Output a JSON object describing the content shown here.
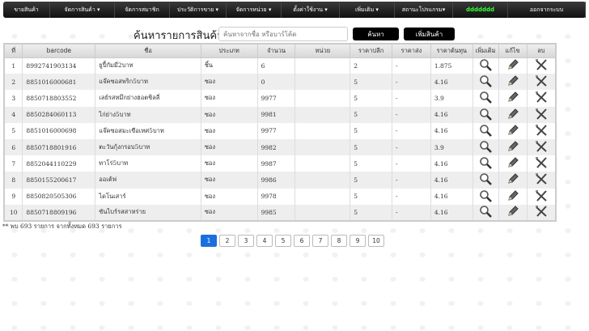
{
  "nav": [
    {
      "label": "ขายสินค้า",
      "w": 58
    },
    {
      "label": "จัดการสินค้า ▾",
      "w": 80
    },
    {
      "label": "จัดการสมาชิก",
      "w": 68
    },
    {
      "label": "ประวัติการขาย ▾",
      "w": 70
    },
    {
      "label": "จัดการหน่วย ▾",
      "w": 68
    },
    {
      "label": "ตั้งค่าใช้งาน ▾",
      "w": 72
    },
    {
      "label": "เพิ่มเติม ▾",
      "w": 68
    },
    {
      "label": "สถานะโปรแกรม▾",
      "w": 72
    },
    {
      "label": "ddddddd",
      "w": 68,
      "green": true
    },
    {
      "label": "ออกจากระบบ",
      "w": 96
    }
  ],
  "search": {
    "title": "ค้นหารายการสินค้า",
    "placeholder": "ค้นหาจากชื่อ หรือบาร์โค้ด",
    "search_label": "ค้นหา",
    "add_label": "เพิ่มสินค้า"
  },
  "table": {
    "headers": [
      "ที่",
      "barcode",
      "ชื่อ",
      "ประเภท",
      "จำนวน",
      "หน่วย",
      "ราคาปลีก",
      "ราคาส่ง",
      "ราคาต้นทุน",
      "เพิ่มเติม",
      "แก้ไข",
      "ลบ"
    ],
    "rows": [
      [
        "1",
        "8992741903134",
        "ยูปี้กัมมี่2บาท",
        "ชิ้น",
        "6",
        "",
        "2",
        "-",
        "1.875"
      ],
      [
        "2",
        "8851016000681",
        "แจ๊คซอสพริก5บาท",
        "ซอง",
        "0",
        "",
        "5",
        "-",
        "4.16"
      ],
      [
        "3",
        "8850718803552",
        "เลย์รสหมึกย่างฮอตชิลลี่",
        "ซอง",
        "9977",
        "",
        "5",
        "-",
        "3.9"
      ],
      [
        "4",
        "8850284060113",
        "ไก่ย่าง5บาท",
        "ซอง",
        "9981",
        "",
        "5",
        "-",
        "4.16"
      ],
      [
        "5",
        "8851016000698",
        "แจ๊คซอสมะเขือเทศ5บาท",
        "ซอง",
        "9977",
        "",
        "5",
        "-",
        "4.16"
      ],
      [
        "6",
        "8850718801916",
        "ตะวันกุ้งกรอบ5บาท",
        "ซอง",
        "9982",
        "",
        "5",
        "-",
        "3.9"
      ],
      [
        "7",
        "8852044110229",
        "ทาโร่5บาท",
        "ซอง",
        "9987",
        "",
        "5",
        "-",
        "4.16"
      ],
      [
        "8",
        "8850155200617",
        "ออเต้ฟ",
        "ซอง",
        "9986",
        "",
        "5",
        "-",
        "4.16"
      ],
      [
        "9",
        "8850820505306",
        "ไดโนเสาร์",
        "ซอง",
        "9978",
        "",
        "5",
        "-",
        "4.16"
      ],
      [
        "10",
        "8850718809196",
        "ซันไบร์รสสาหร่าย",
        "ซอง",
        "9985",
        "",
        "5",
        "-",
        "4.16"
      ]
    ]
  },
  "footer": "** พบ 693 รายการ จากทั้งหมด 693 รายการ",
  "pagination": {
    "pages": [
      "1",
      "2",
      "3",
      "4",
      "5",
      "6",
      "7",
      "8",
      "9",
      "10"
    ],
    "current": "1"
  }
}
